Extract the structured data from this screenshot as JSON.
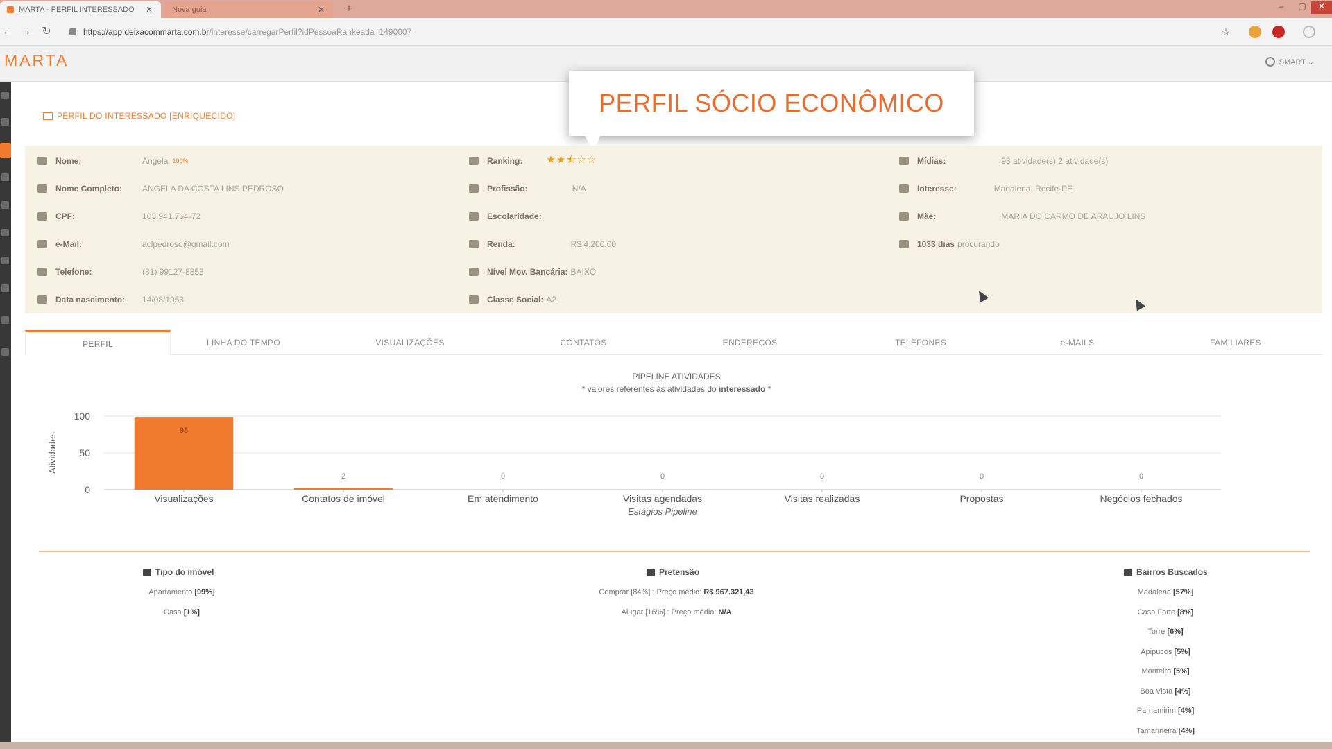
{
  "browser": {
    "tabs": [
      {
        "label": "MARTA - PERFIL INTERESSADO",
        "active": true
      },
      {
        "label": "Nova guia",
        "active": false
      }
    ],
    "new_tab": "+",
    "url_host": "https://app.deixacommarta.com.br",
    "url_path": "/interesse/carregarPerfil?idPessoaRankeada=1490007"
  },
  "app": {
    "logo": "MARTA",
    "user": "SMART ⌄"
  },
  "page": {
    "title": "PERFIL DO INTERESSADO [ENRIQUECIDO]",
    "callout": "PERFIL SÓCIO ECONÔMICO"
  },
  "profile": {
    "col1": [
      {
        "label": "Nome:",
        "value": "Angela",
        "icon": "user-icon"
      },
      {
        "label": "Nome Completo:",
        "value": "ANGELA DA COSTA LINS PEDROSO",
        "icon": "user-plus-icon"
      },
      {
        "label": "CPF:",
        "value": "103.941.764-72",
        "icon": "id-card-icon"
      },
      {
        "label": "e-Mail:",
        "value": "aclpedroso@gmail.com",
        "icon": "envelope-icon"
      },
      {
        "label": "Telefone:",
        "value": "(81) 99127-8853",
        "icon": "phone-icon"
      },
      {
        "label": "Data nascimento:",
        "value": "14/08/1953",
        "icon": "calendar-icon"
      }
    ],
    "name_badge": "100%",
    "col2": [
      {
        "label": "Ranking:",
        "value": "",
        "icon": "trophy-icon"
      },
      {
        "label": "Profissão:",
        "value": "N/A",
        "icon": "briefcase-icon"
      },
      {
        "label": "Escolaridade:",
        "value": "",
        "icon": "graduation-cap-icon"
      },
      {
        "label": "Renda:",
        "value": "R$ 4.200,00",
        "icon": "dollar-icon"
      },
      {
        "label": "Nível Mov. Bancária:",
        "value": "BAIXO",
        "icon": "bank-icon"
      },
      {
        "label": "Classe Social:",
        "value": "A2",
        "icon": "users-icon"
      }
    ],
    "ranking_stars": "★★⯪☆☆",
    "col3": [
      {
        "label": "Mídias:",
        "value": "93 atividade(s)   2 atividade(s)",
        "icon": "rss-icon"
      },
      {
        "label": "Interesse:",
        "value": "Madalena, Recife-PE",
        "icon": "map-marker-icon"
      },
      {
        "label": "Mãe:",
        "value": "MARIA DO CARMO DE ARAUJO LINS",
        "icon": "female-icon"
      },
      {
        "label": "1033 dias",
        "value": "procurando",
        "icon": "calendar-icon"
      }
    ]
  },
  "tabs": [
    "PERFIL",
    "LINHA DO TEMPO",
    "VISUALIZAÇÕES",
    "CONTATOS",
    "ENDEREÇOS",
    "TELEFONES",
    "e-MAILS",
    "FAMILIARES"
  ],
  "chart_data": {
    "type": "bar",
    "title": "PIPELINE ATIVIDADES",
    "subtitle_prefix": "* valores referentes às atividades do ",
    "subtitle_bold": "interessado",
    "subtitle_suffix": " *",
    "categories": [
      "Visualizações",
      "Contatos de imóvel",
      "Em atendimento",
      "Visitas agendadas",
      "Visitas realizadas",
      "Propostas",
      "Negócios fechados"
    ],
    "values": [
      98,
      2,
      0,
      0,
      0,
      0,
      0
    ],
    "data_labels": [
      "98",
      "2",
      "0",
      "0",
      "0",
      "0",
      "0"
    ],
    "xlabel": "Estágios Pipeline",
    "ylabel": "Atividades",
    "ylim": [
      0,
      100
    ],
    "yticks": [
      "100",
      "50",
      "0"
    ],
    "color": "#f07a2d",
    "grid": true
  },
  "summary": {
    "tipo": {
      "header": "Tipo do imóvel",
      "lines": [
        {
          "text": "Apartamento ",
          "bold": "[99%]"
        },
        {
          "text": "Casa ",
          "bold": "[1%]"
        }
      ]
    },
    "pretensao": {
      "header": "Pretensão",
      "lines": [
        {
          "text": "Comprar [84%] : Preço médio: ",
          "bold": "R$ 967.321,43"
        },
        {
          "text": "Alugar [16%] : Preço médio: ",
          "bold": "N/A"
        }
      ]
    },
    "bairros": {
      "header": "Bairros Buscados",
      "lines": [
        {
          "text": "Madalena ",
          "bold": "[57%]"
        },
        {
          "text": "Casa Forte ",
          "bold": "[8%]"
        },
        {
          "text": "Torre ",
          "bold": "[6%]"
        },
        {
          "text": "Apipucos ",
          "bold": "[5%]"
        },
        {
          "text": "Monteiro ",
          "bold": "[5%]"
        },
        {
          "text": "Boa Vista ",
          "bold": "[4%]"
        },
        {
          "text": "Parnamirim ",
          "bold": "[4%]"
        },
        {
          "text": "Tamarineira ",
          "bold": "[4%]"
        }
      ]
    }
  }
}
